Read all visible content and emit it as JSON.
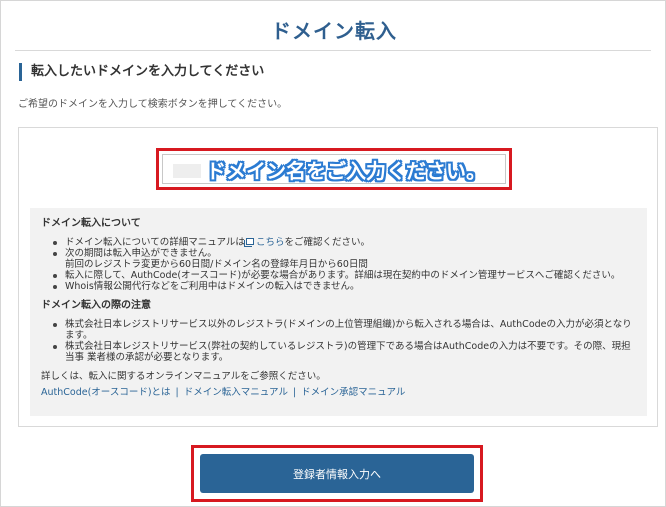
{
  "page": {
    "title": "ドメイン転入"
  },
  "section": {
    "heading": "転入したいドメインを入力してください",
    "lead": "ご希望のドメインを入力して検索ボタンを押してください。"
  },
  "search": {
    "placeholder": "ドメイン名をご入力ください。"
  },
  "notes": {
    "about_heading": "ドメイン転入について",
    "about_items": [
      {
        "text_before": "ドメイン転入についての詳細マニュアルは",
        "link": "こちら",
        "text_after": "をご確認ください。"
      },
      {
        "text": "次の期間は転入申込ができません。",
        "sub": "前回のレジストラ変更から60日間/ドメイン名の登録年月日から60日間"
      },
      {
        "text": "転入に際して、AuthCode(オースコード)が必要な場合があります。詳細は現在契約中のドメイン管理サービスへご確認ください。"
      },
      {
        "text": "Whois情報公開代行などをご利用中はドメインの転入はできません。"
      }
    ],
    "caution_heading": "ドメイン転入の際の注意",
    "caution_items": [
      {
        "text": "株式会社日本レジストリサービス以外のレジストラ(ドメインの上位管理組織)から転入される場合は、AuthCodeの入力が必須となります。"
      },
      {
        "text": "株式会社日本レジストリサービス(弊社の契約しているレジストラ)の管理下である場合はAuthCodeの入力は不要です。その際、現担当事 業者様の承認が必要となります。"
      }
    ],
    "more_text": "詳しくは、転入に関するオンラインマニュアルをご参照ください。",
    "links": [
      "AuthCode(オースコード)とは",
      "ドメイン転入マニュアル",
      "ドメイン承認マニュアル"
    ],
    "link_separator": "|"
  },
  "actions": {
    "next_label": "登録者情報入力へ"
  },
  "colors": {
    "accent": "#2a6496",
    "title": "#2f5f8f",
    "highlight": "#d71920",
    "placeholder_outline": "#2b7bd2",
    "notes_bg": "#f2f2f2"
  },
  "icons": {
    "external_link": "external-link-icon"
  }
}
